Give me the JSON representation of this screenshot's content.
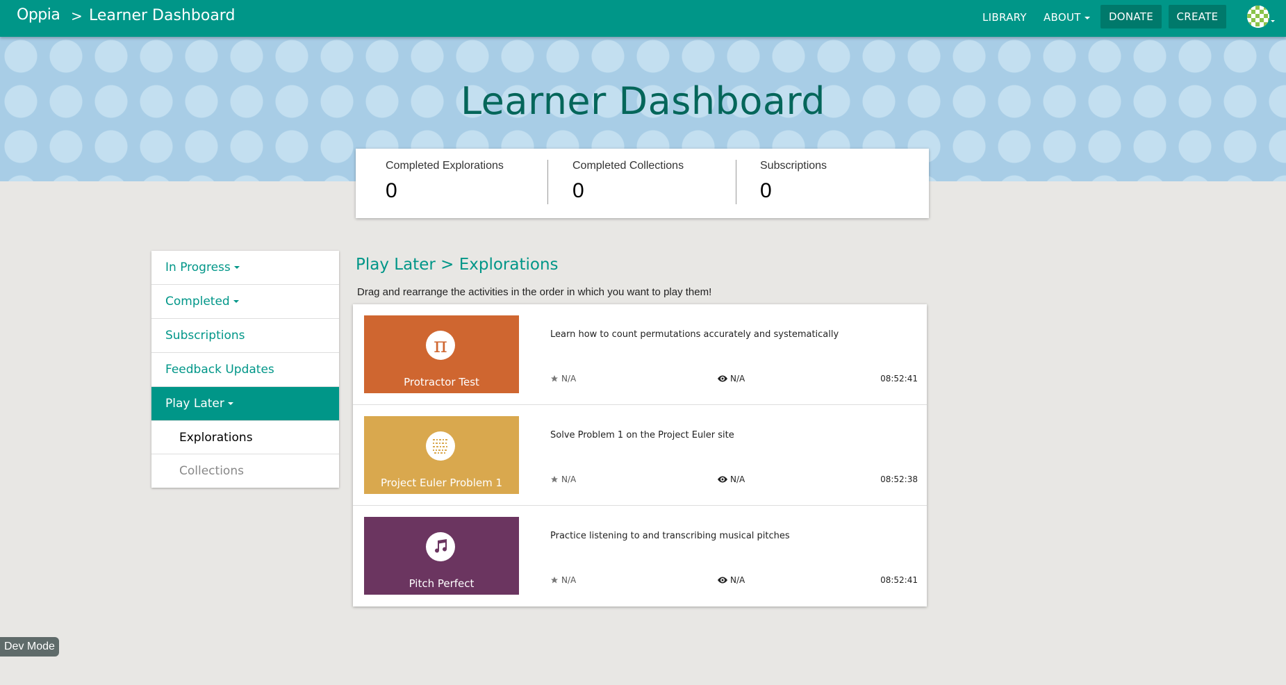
{
  "navbar": {
    "brand": "Oppia",
    "separator": ">",
    "page_title": "Learner Dashboard",
    "links": {
      "library": "LIBRARY",
      "about": "ABOUT"
    },
    "buttons": {
      "donate": "DONATE",
      "create": "CREATE"
    },
    "color": "#009688"
  },
  "banner": {
    "title": "Learner Dashboard"
  },
  "stats": [
    {
      "label": "Completed Explorations",
      "value": "0"
    },
    {
      "label": "Completed Collections",
      "value": "0"
    },
    {
      "label": "Subscriptions",
      "value": "0"
    }
  ],
  "sidebar": {
    "items": [
      {
        "label": "In Progress"
      },
      {
        "label": "Completed"
      },
      {
        "label": "Subscriptions"
      },
      {
        "label": "Feedback Updates"
      },
      {
        "label": "Play Later"
      }
    ],
    "subitems": [
      {
        "label": "Explorations"
      },
      {
        "label": "Collections"
      }
    ]
  },
  "main": {
    "title": "Play Later > Explorations",
    "description": "Drag and rearrange the activities in the order in which you want to play them!",
    "explorations": [
      {
        "title": "Protractor Test",
        "icon": "pi-icon",
        "color": "#cf6630",
        "description": "Learn how to count permutations accurately and systematically",
        "rating": "N/A",
        "views": "N/A",
        "time": "08:52:41"
      },
      {
        "title": "Project Euler Problem 1",
        "icon": "binary-grid-icon",
        "color": "#d9a84e",
        "description": "Solve Problem 1 on the Project Euler site",
        "rating": "N/A",
        "views": "N/A",
        "time": "08:52:38"
      },
      {
        "title": "Pitch Perfect",
        "icon": "music-note-icon",
        "color": "#6b3560",
        "description": "Practice listening to and transcribing musical pitches",
        "rating": "N/A",
        "views": "N/A",
        "time": "08:52:41"
      }
    ]
  },
  "dev_mode": "Dev Mode"
}
